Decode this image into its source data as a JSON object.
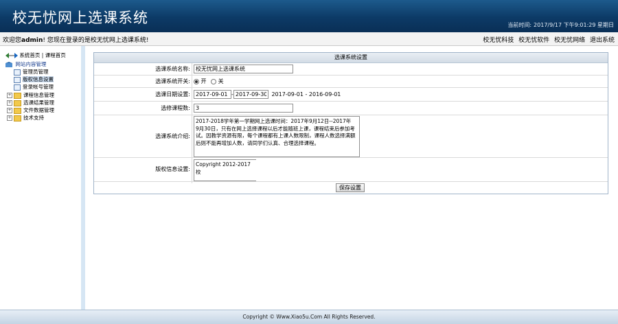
{
  "header": {
    "title": "校无忧网上选课系统",
    "clock_label": "当前时间",
    "clock_value": "2017/9/17 下午9:01:29 星期日"
  },
  "infobar": {
    "welcome_prefix": "欢迎您",
    "username": "admin",
    "welcome_suffix": "! 您现在登录的是校无忧网上选课系统!",
    "links": [
      "校无忧科技",
      "校无忧软件",
      "校无忧网络",
      "退出系统"
    ]
  },
  "sidebar": {
    "top_links": [
      "系统首页",
      "课程首页"
    ],
    "top_sep": "|",
    "root_label": "网站内容管理",
    "items": [
      {
        "label": "管理员管理",
        "type": "page"
      },
      {
        "label": "版权信息设置",
        "type": "page",
        "selected": true
      },
      {
        "label": "登录帐号管理",
        "type": "page"
      },
      {
        "label": "课程信息管理",
        "type": "folder"
      },
      {
        "label": "选课结果管理",
        "type": "folder"
      },
      {
        "label": "文件数据管理",
        "type": "folder"
      },
      {
        "label": "技术支持",
        "type": "folder"
      }
    ]
  },
  "main": {
    "panel_title": "选课系统设置",
    "fields": {
      "name_label": "选课系统名称:",
      "name_value": "校无忧网上选课系统",
      "switch_label": "选课系统开关:",
      "switch_on": "开",
      "switch_off": "关",
      "switch_selected": "开",
      "date_label": "选课日期设置:",
      "date_start": "2017-09-01",
      "date_sep": "-",
      "date_end": "2017-09-30",
      "date_note": "2017-09-01 - 2016-09-01",
      "course_count_label": "选修课程数:",
      "course_count_value": "3",
      "intro_label": "选课系统介绍:",
      "intro_value": "2017-2018学年第一学期网上选课时间：2017年9月12日--2017年\n9月30日，只有在网上选择课程以后才能随班上课，课程结束后参加考\n试。因教学资源有限，每个课程都有上课人数限制，课程人数选择满额\n后则不能再增加人数，请同学们认真、合理选择课程。",
      "copyright_label": "版权信息设置:",
      "copyright_value": "Copyright 2012-2017 校"
    },
    "save_button": "保存设置"
  },
  "footer": {
    "text": "Copyright © Www.Xiao5u.Com All Rights Reserved."
  }
}
